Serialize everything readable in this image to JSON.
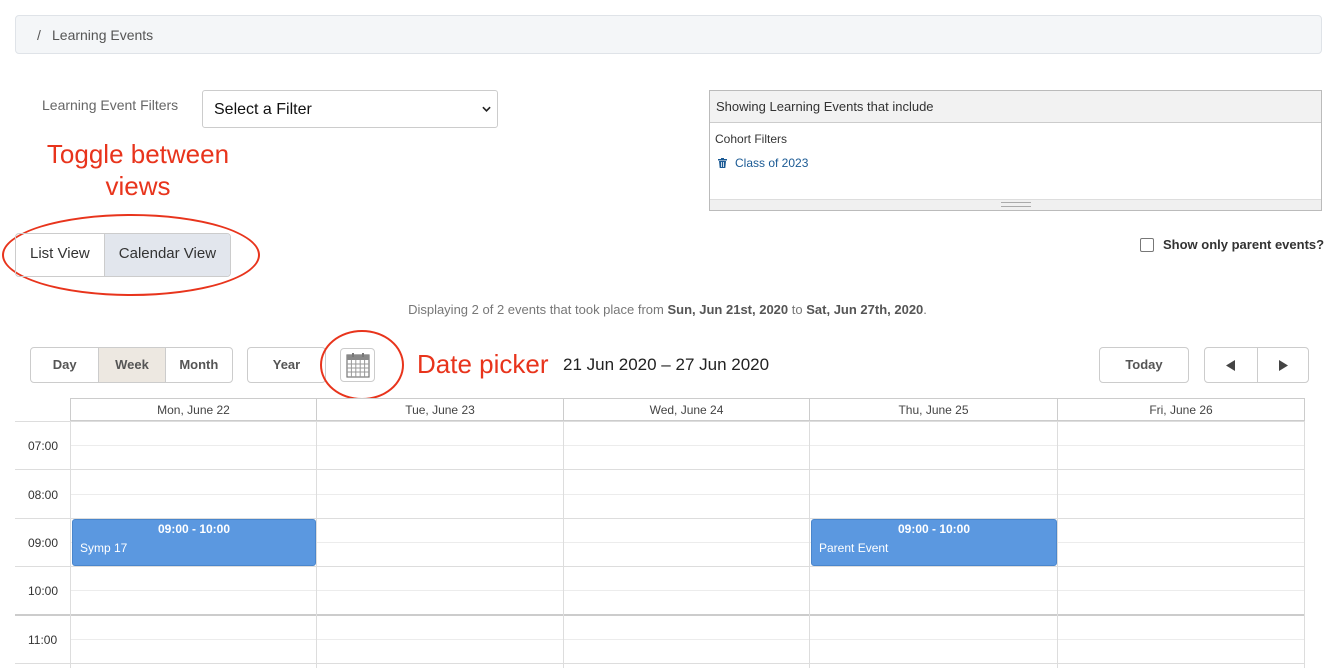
{
  "breadcrumb": {
    "separator": "/",
    "current": "Learning Events"
  },
  "filters": {
    "label": "Learning Event Filters",
    "select_value": "Select a Filter"
  },
  "annotations": {
    "toggle_line1": "Toggle between",
    "toggle_line2": "views",
    "date_picker": "Date picker",
    "color": "#e8341c"
  },
  "view_toggle": {
    "list": "List View",
    "calendar": "Calendar View",
    "active": "Calendar View"
  },
  "showing": {
    "header": "Showing Learning Events that include",
    "group_label": "Cohort Filters",
    "items": [
      "Class of 2023"
    ],
    "item_icon": "trash-icon"
  },
  "parent_only": {
    "label": "Show only parent events?",
    "checked": false
  },
  "displaying": {
    "prefix": "Displaying 2 of 2 events that took place from ",
    "start": "Sun, Jun 21st, 2020",
    "mid": " to ",
    "end": "Sat, Jun 27th, 2020",
    "suffix": "."
  },
  "calendar_toolbar": {
    "day": "Day",
    "week": "Week",
    "month": "Month",
    "year": "Year",
    "active": "Week",
    "date_picker_icon": "calendar-grid-icon",
    "date_range": "21 Jun 2020 – 27 Jun 2020",
    "today": "Today",
    "prev_icon": "triangle-left-icon",
    "next_icon": "triangle-right-icon"
  },
  "calendar": {
    "days": [
      "Mon, June 22",
      "Tue, June 23",
      "Wed, June 24",
      "Thu, June 25",
      "Fri, June 26"
    ],
    "times": [
      "07:00",
      "08:00",
      "09:00",
      "10:00",
      "11:00"
    ],
    "events": [
      {
        "day": "Mon, June 22",
        "time": "09:00 - 10:00",
        "name": "Symp 17"
      },
      {
        "day": "Thu, June 25",
        "time": "09:00 - 10:00",
        "name": "Parent Event"
      }
    ],
    "event_color": "#5b98e0"
  }
}
